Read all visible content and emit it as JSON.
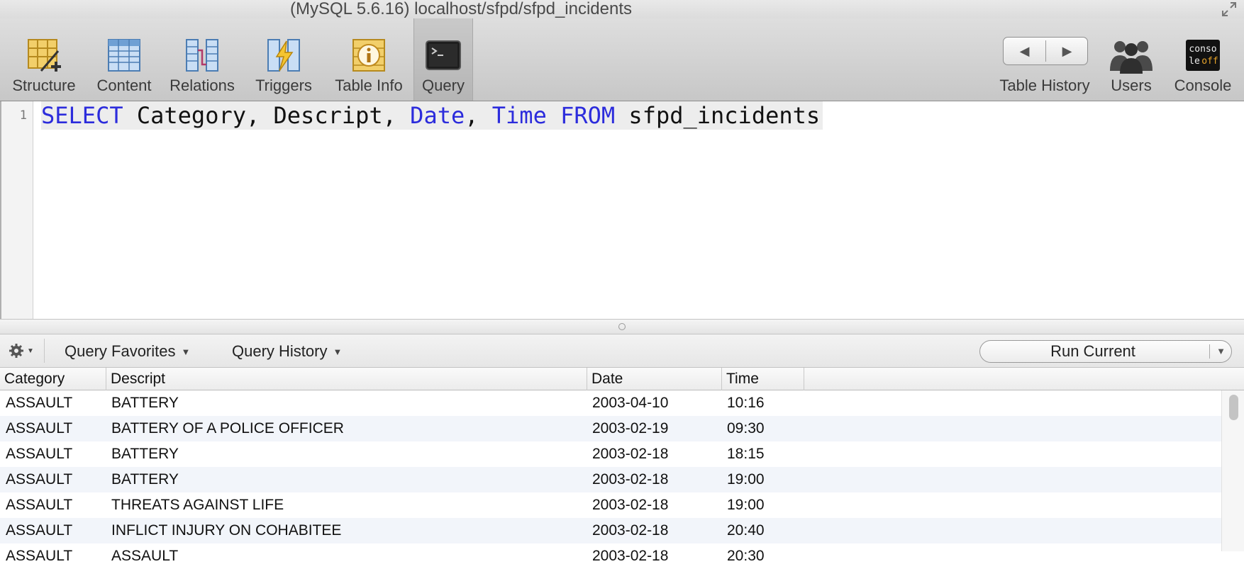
{
  "window": {
    "title": "(MySQL 5.6.16) localhost/sfpd/sfpd_incidents"
  },
  "toolbar": {
    "items": [
      {
        "label": "Structure",
        "icon": "structure-icon"
      },
      {
        "label": "Content",
        "icon": "content-icon"
      },
      {
        "label": "Relations",
        "icon": "relations-icon"
      },
      {
        "label": "Triggers",
        "icon": "triggers-icon"
      },
      {
        "label": "Table Info",
        "icon": "table-info-icon"
      },
      {
        "label": "Query",
        "icon": "query-icon",
        "active": true
      }
    ],
    "right_items": [
      {
        "label": "Table History",
        "icon": "history-nav-icon"
      },
      {
        "label": "Users",
        "icon": "users-icon"
      },
      {
        "label": "Console",
        "icon": "console-icon"
      }
    ],
    "console_icon_text": [
      "conso",
      "le",
      "off"
    ]
  },
  "editor": {
    "line_number": "1",
    "tokens": [
      {
        "text": "SELECT",
        "keyword": true
      },
      {
        "text": " Category, Descript, ",
        "keyword": false
      },
      {
        "text": "Date",
        "keyword": true
      },
      {
        "text": ", ",
        "keyword": false
      },
      {
        "text": "Time",
        "keyword": true
      },
      {
        "text": " ",
        "keyword": false
      },
      {
        "text": "FROM",
        "keyword": true
      },
      {
        "text": " sfpd_incidents",
        "keyword": false
      }
    ]
  },
  "querybar": {
    "favorites_label": "Query Favorites",
    "history_label": "Query History",
    "run_label": "Run Current"
  },
  "results": {
    "columns": [
      "Category",
      "Descript",
      "Date",
      "Time"
    ],
    "rows": [
      [
        "ASSAULT",
        "BATTERY",
        "2003-04-10",
        "10:16"
      ],
      [
        "ASSAULT",
        "BATTERY OF A POLICE OFFICER",
        "2003-02-19",
        "09:30"
      ],
      [
        "ASSAULT",
        "BATTERY",
        "2003-02-18",
        "18:15"
      ],
      [
        "ASSAULT",
        "BATTERY",
        "2003-02-18",
        "19:00"
      ],
      [
        "ASSAULT",
        "THREATS AGAINST LIFE",
        "2003-02-18",
        "19:00"
      ],
      [
        "ASSAULT",
        "INFLICT INJURY ON COHABITEE",
        "2003-02-18",
        "20:40"
      ],
      [
        "ASSAULT",
        "ASSAULT",
        "2003-02-18",
        "20:30"
      ]
    ]
  },
  "colors": {
    "keyword": "#2c2cdc",
    "row_stripe": "#f2f5fa"
  }
}
